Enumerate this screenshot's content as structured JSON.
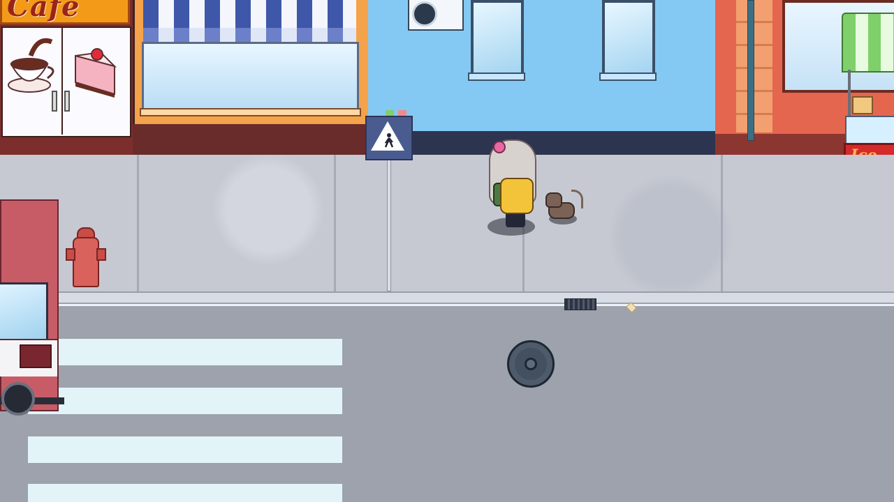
{
  "scene": {
    "type": "top-down city street game view",
    "colors": {
      "sidewalk": "#c6c9d2",
      "road": "#9da2ad",
      "crosswalk": "#e3f4f8",
      "blue_building": "#84c9f3",
      "cafe_sign": "#f39a18",
      "ice_cream_cart": "#d52a2a"
    }
  },
  "storefronts": {
    "cafe_sign_text": "Cafe",
    "ice_cream_sign_text": "Ice Cr"
  },
  "characters": {
    "player": {
      "icon": "girl-character-sprite"
    },
    "companion": {
      "icon": "cat-sprite"
    }
  },
  "props": {
    "pedestrian_sign_icon": "pedestrian-crossing-sign-icon",
    "pedestrian_glyph": "🚸",
    "hydrant_icon": "fire-hydrant-icon",
    "manhole_icon": "manhole-cover-icon",
    "truck_icon": "red-truck-icon"
  }
}
